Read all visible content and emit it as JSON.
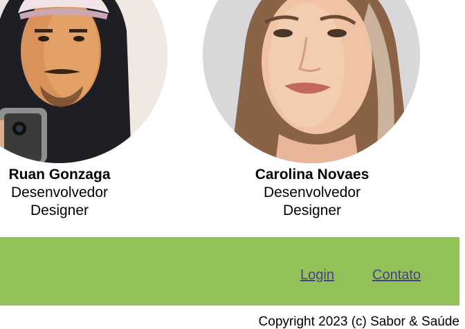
{
  "team": [
    {
      "name": "Ruan Gonzaga",
      "roles": [
        "Desenvolvedor",
        "Designer"
      ]
    },
    {
      "name": "Carolina Novaes",
      "roles": [
        "Desenvolvedor",
        "Designer"
      ]
    }
  ],
  "footer": {
    "links": [
      "Login",
      "Contato"
    ],
    "background": "#92c257",
    "link_color": "#4b3d8f"
  },
  "copyright": "Copyright 2023 (c) Sabor & Saúde"
}
